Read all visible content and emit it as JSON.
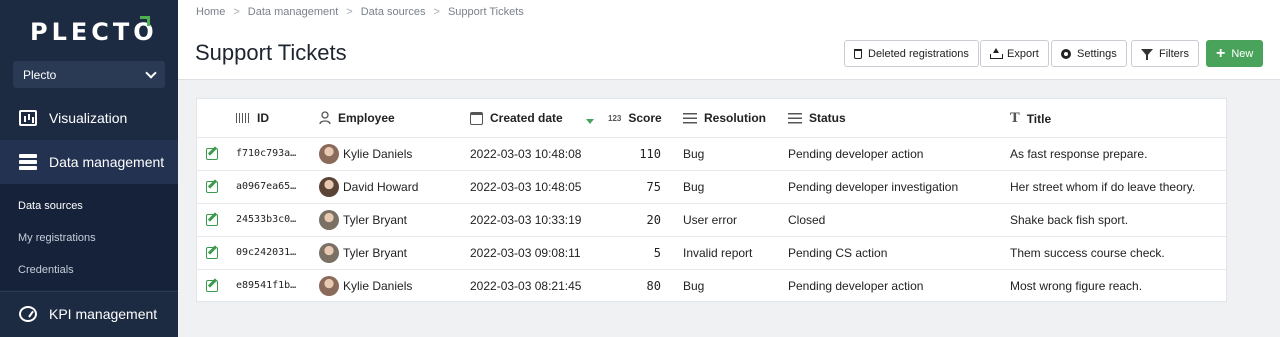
{
  "app": {
    "logo": "PLECTO",
    "org_name": "Plecto"
  },
  "sidebar": {
    "items": [
      {
        "label": "Visualization",
        "icon": "chart-icon"
      },
      {
        "label": "Data management",
        "icon": "database-icon"
      },
      {
        "label": "KPI management",
        "icon": "gauge-icon"
      }
    ],
    "subitems": [
      {
        "label": "Data sources",
        "active": true
      },
      {
        "label": "My registrations",
        "active": false
      },
      {
        "label": "Credentials",
        "active": false
      }
    ]
  },
  "breadcrumb": [
    "Home",
    "Data management",
    "Data sources",
    "Support Tickets"
  ],
  "page_title": "Support Tickets",
  "toolbar": {
    "deleted_label": "Deleted registrations",
    "export_label": "Export",
    "settings_label": "Settings",
    "filters_label": "Filters",
    "new_label": "New"
  },
  "table": {
    "columns": [
      "ID",
      "Employee",
      "Created date",
      "Score",
      "Resolution",
      "Status",
      "Title"
    ],
    "score_icon_text": "123",
    "rows": [
      {
        "id": "f710c793a…",
        "employee": "Kylie Daniels",
        "created": "2022-03-03 10:48:08",
        "score": "110",
        "resolution": "Bug",
        "status": "Pending developer action",
        "title": "As fast response prepare.",
        "avatar_color": "#8a6a5a"
      },
      {
        "id": "a0967ea65…",
        "employee": "David Howard",
        "created": "2022-03-03 10:48:05",
        "score": "75",
        "resolution": "Bug",
        "status": "Pending developer investigation",
        "title": "Her street whom if do leave theory.",
        "avatar_color": "#5a4436"
      },
      {
        "id": "24533b3c0…",
        "employee": "Tyler Bryant",
        "created": "2022-03-03 10:33:19",
        "score": "20",
        "resolution": "User error",
        "status": "Closed",
        "title": "Shake back fish sport.",
        "avatar_color": "#7a7064"
      },
      {
        "id": "09c242031…",
        "employee": "Tyler Bryant",
        "created": "2022-03-03 09:08:11",
        "score": "5",
        "resolution": "Invalid report",
        "status": "Pending CS action",
        "title": "Them success course check.",
        "avatar_color": "#7a7064"
      },
      {
        "id": "e89541f1b…",
        "employee": "Kylie Daniels",
        "created": "2022-03-03 08:21:45",
        "score": "80",
        "resolution": "Bug",
        "status": "Pending developer action",
        "title": "Most wrong figure reach.",
        "avatar_color": "#8a6a5a"
      }
    ]
  },
  "colors": {
    "sidebar_bg": "#1d2b42",
    "accent_green": "#4aa35a"
  }
}
